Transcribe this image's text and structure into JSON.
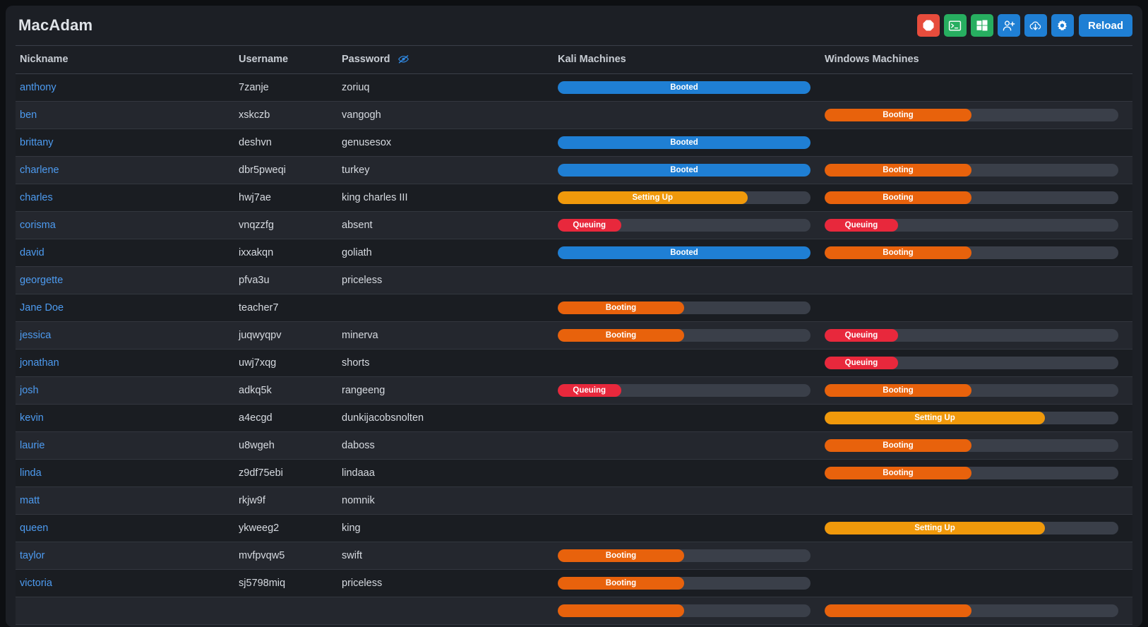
{
  "app": {
    "title": "MacAdam"
  },
  "toolbar": {
    "buttons": [
      {
        "name": "stop-button",
        "icon": "stop-octagon-icon",
        "color": "#e74c3c"
      },
      {
        "name": "terminal-button",
        "icon": "terminal-icon",
        "color": "#27ae60"
      },
      {
        "name": "windows-button",
        "icon": "windows-logo-icon",
        "color": "#27ae60"
      },
      {
        "name": "add-user-button",
        "icon": "user-plus-icon",
        "color": "#1f7fd4"
      },
      {
        "name": "download-button",
        "icon": "cloud-download-icon",
        "color": "#1f7fd4"
      },
      {
        "name": "settings-button",
        "icon": "gear-icon",
        "color": "#1f7fd4"
      }
    ],
    "reload_label": "Reload"
  },
  "table": {
    "headers": {
      "nickname": "Nickname",
      "username": "Username",
      "password": "Password",
      "password_toggle_icon": "eye-slash-icon",
      "kali": "Kali Machines",
      "windows": "Windows Machines"
    },
    "rows": [
      {
        "nickname": "anthony",
        "username": "7zanje",
        "password": "zoriuq",
        "kali": {
          "status": "Booted",
          "percent": 100,
          "state": "booted"
        },
        "windows": null
      },
      {
        "nickname": "ben",
        "username": "xskczb",
        "password": "vangogh",
        "kali": null,
        "windows": {
          "status": "Booting",
          "percent": 50,
          "state": "booting"
        }
      },
      {
        "nickname": "brittany",
        "username": "deshvn",
        "password": "genusesox",
        "kali": {
          "status": "Booted",
          "percent": 100,
          "state": "booted"
        },
        "windows": null
      },
      {
        "nickname": "charlene",
        "username": "dbr5pweqi",
        "password": "turkey",
        "kali": {
          "status": "Booted",
          "percent": 100,
          "state": "booted"
        },
        "windows": {
          "status": "Booting",
          "percent": 50,
          "state": "booting"
        }
      },
      {
        "nickname": "charles",
        "username": "hwj7ae",
        "password": "king charles III",
        "kali": {
          "status": "Setting Up",
          "percent": 75,
          "state": "settingup"
        },
        "windows": {
          "status": "Booting",
          "percent": 50,
          "state": "booting"
        }
      },
      {
        "nickname": "corisma",
        "username": "vnqzzfg",
        "password": "absent",
        "kali": {
          "status": "Queuing",
          "percent": 25,
          "state": "queuing"
        },
        "windows": {
          "status": "Queuing",
          "percent": 25,
          "state": "queuing"
        }
      },
      {
        "nickname": "david",
        "username": "ixxakqn",
        "password": "goliath",
        "kali": {
          "status": "Booted",
          "percent": 100,
          "state": "booted"
        },
        "windows": {
          "status": "Booting",
          "percent": 50,
          "state": "booting"
        }
      },
      {
        "nickname": "georgette",
        "username": "pfva3u",
        "password": "priceless",
        "kali": null,
        "windows": null
      },
      {
        "nickname": "Jane Doe",
        "username": "teacher7",
        "password": "",
        "kali": {
          "status": "Booting",
          "percent": 50,
          "state": "booting"
        },
        "windows": null
      },
      {
        "nickname": "jessica",
        "username": "juqwyqpv",
        "password": "minerva",
        "kali": {
          "status": "Booting",
          "percent": 50,
          "state": "booting"
        },
        "windows": {
          "status": "Queuing",
          "percent": 25,
          "state": "queuing"
        }
      },
      {
        "nickname": "jonathan",
        "username": "uwj7xqg",
        "password": "shorts",
        "kali": null,
        "windows": {
          "status": "Queuing",
          "percent": 25,
          "state": "queuing"
        }
      },
      {
        "nickname": "josh",
        "username": "adkq5k",
        "password": "rangeeng",
        "kali": {
          "status": "Queuing",
          "percent": 25,
          "state": "queuing"
        },
        "windows": {
          "status": "Booting",
          "percent": 50,
          "state": "booting"
        }
      },
      {
        "nickname": "kevin",
        "username": "a4ecgd",
        "password": "dunkijacobsnolten",
        "kali": null,
        "windows": {
          "status": "Setting Up",
          "percent": 75,
          "state": "settingup"
        }
      },
      {
        "nickname": "laurie",
        "username": "u8wgeh",
        "password": "daboss",
        "kali": null,
        "windows": {
          "status": "Booting",
          "percent": 50,
          "state": "booting"
        }
      },
      {
        "nickname": "linda",
        "username": "z9df75ebi",
        "password": "lindaaa",
        "kali": null,
        "windows": {
          "status": "Booting",
          "percent": 50,
          "state": "booting"
        }
      },
      {
        "nickname": "matt",
        "username": "rkjw9f",
        "password": "nomnik",
        "kali": null,
        "windows": null
      },
      {
        "nickname": "queen",
        "username": "ykweeg2",
        "password": "king",
        "kali": null,
        "windows": {
          "status": "Setting Up",
          "percent": 75,
          "state": "settingup"
        }
      },
      {
        "nickname": "taylor",
        "username": "mvfpvqw5",
        "password": "swift",
        "kali": {
          "status": "Booting",
          "percent": 50,
          "state": "booting"
        },
        "windows": null
      },
      {
        "nickname": "victoria",
        "username": "sj5798miq",
        "password": "priceless",
        "kali": {
          "status": "Booting",
          "percent": 50,
          "state": "booting"
        },
        "windows": null
      },
      {
        "nickname": "",
        "username": "",
        "password": "",
        "kali": {
          "status": "",
          "percent": 50,
          "state": "booting"
        },
        "windows": {
          "status": "",
          "percent": 50,
          "state": "booting"
        }
      }
    ]
  },
  "colors": {
    "booted": "#1f7fd4",
    "booting": "#e8620c",
    "settingup": "#f0990b",
    "queuing": "#e8283c",
    "track": "#3a3f49",
    "link": "#4d9bf0",
    "accent": "#1f7fd4"
  }
}
